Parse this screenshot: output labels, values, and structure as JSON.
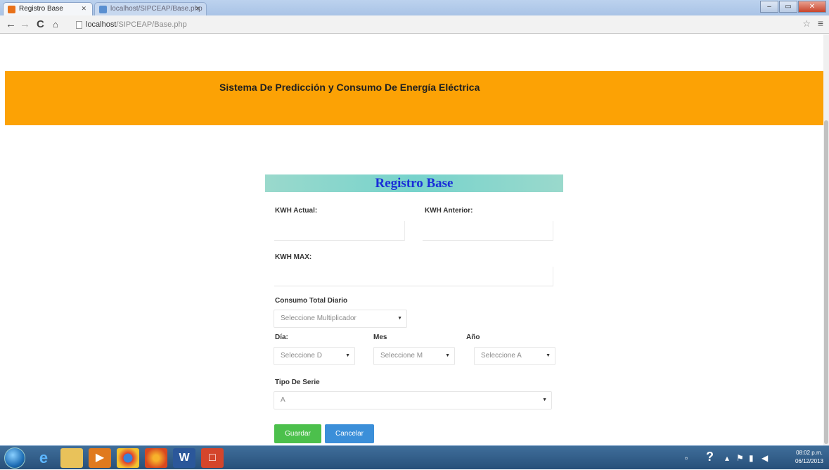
{
  "browser": {
    "tabs": [
      {
        "title": "Registro Base",
        "active": true
      },
      {
        "title": "localhost/SIPCEAP/Base.php",
        "active": false
      }
    ],
    "url_host": "localhost",
    "url_path": "/SIPCEAP/Base.php",
    "icons": {
      "back": "back-arrow-icon",
      "forward": "forward-arrow-icon",
      "reload": "reload-icon",
      "home": "home-icon",
      "star": "star-icon",
      "menu": "hamburger-menu-icon"
    }
  },
  "header": {
    "title": "Sistema De Predicción y Consumo De Energía Eléctrica",
    "color": "#fca205"
  },
  "form": {
    "title": "Registro Base",
    "header_color": "#77d3cc",
    "kwh_actual_label": "KWH Actual:",
    "kwh_anterior_label": "KWH Anterior:",
    "kwh_max_label": "KWH MAX:",
    "consumo_label": "Consumo Total Diario",
    "multiplicador_value": "Seleccione Multiplicador",
    "dia_label": "Día:",
    "dia_value": "Seleccione D",
    "mes_label": "Mes",
    "mes_value": "Seleccione M",
    "anio_label": "Año",
    "anio_value": "Seleccione A",
    "tipo_serie_label": "Tipo De Serie",
    "tipo_serie_value": "A",
    "save_button": "Guardar",
    "cancel_button": "Cancelar"
  },
  "taskbar": {
    "apps": [
      "ie-icon",
      "explorer-icon",
      "media-player-icon",
      "chrome-icon",
      "firefox-icon",
      "word-icon",
      "app-icon"
    ],
    "clock_time": "08:02 p.m.",
    "clock_date": "06/12/2013"
  }
}
